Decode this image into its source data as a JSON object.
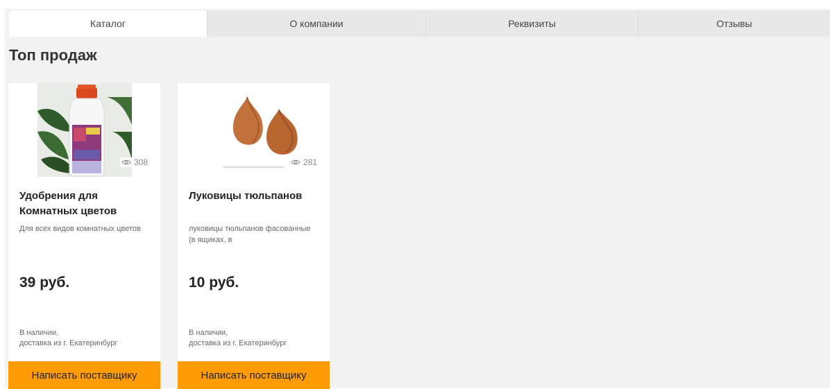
{
  "tabs": [
    {
      "label": "Каталог",
      "active": true
    },
    {
      "label": "О компании",
      "active": false
    },
    {
      "label": "Реквизиты",
      "active": false
    },
    {
      "label": "Отзывы",
      "active": false
    }
  ],
  "section_title": "Топ продаж",
  "products": [
    {
      "title": "Удобрения для Комнатных цветов",
      "description": "Для всех видов комнатных цветов",
      "price": "39 руб.",
      "views": "308",
      "stock_line1": "В наличии,",
      "stock_line2": "доставка из г. Екатеринбург",
      "button": "Написать поставщику"
    },
    {
      "title": "Луковицы тюльпанов",
      "description": "луковицы тюльпанов фасованные (в ящиках, в",
      "price": "10 руб.",
      "views": "281",
      "stock_line1": "В наличии,",
      "stock_line2": "доставка из г. Екатеринбург",
      "button": "Написать поставщику"
    }
  ],
  "colors": {
    "accent": "#ff9b05",
    "panel_bg": "#f2f2f2",
    "tab_bg": "#e8e8e8"
  },
  "icons": {
    "views": "eye-icon"
  }
}
